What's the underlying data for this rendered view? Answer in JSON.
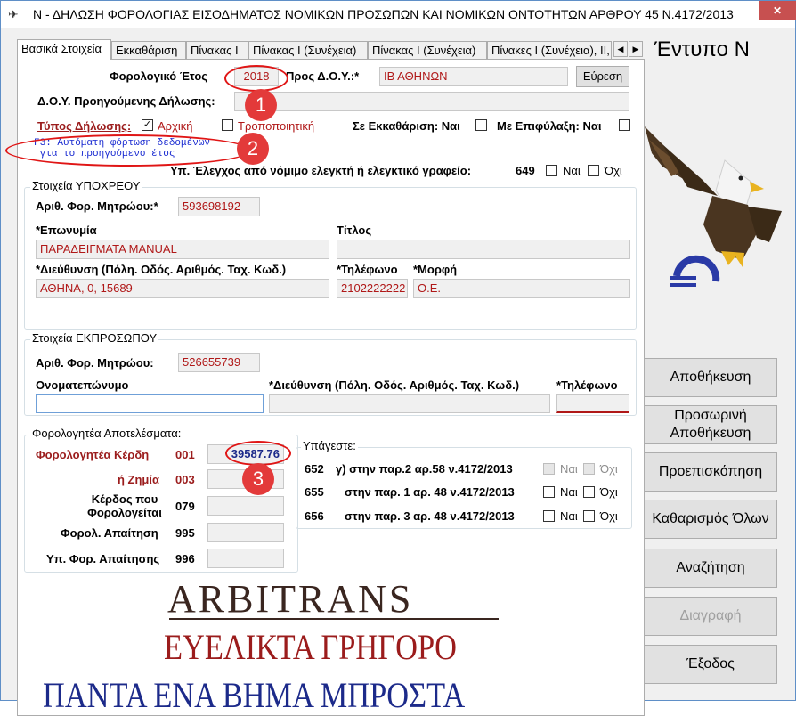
{
  "window": {
    "title": "Ν - ΔΗΛΩΣΗ ΦΟΡΟΛΟΓΙΑΣ ΕΙΣΟΔΗΜΑΤΟΣ ΝΟΜΙΚΩΝ ΠΡΟΣΩΠΩΝ ΚΑΙ ΝΟΜΙΚΩΝ ΟΝΤΟΤΗΤΩΝ ΑΡΘΡΟΥ 45 Ν.4172/2013",
    "close_label": "✕"
  },
  "tabs": [
    {
      "label": "Βασικά Στοιχεία"
    },
    {
      "label": "Εκκαθάριση"
    },
    {
      "label": "Πίνακας Ι"
    },
    {
      "label": "Πίνακας Ι (Συνέχεια)"
    },
    {
      "label": "Πίνακας Ι (Συνέχεια)"
    },
    {
      "label": "Πίνακες Ι (Συνέχεια), ΙΙ,"
    }
  ],
  "tab_arrows": {
    "left": "◀",
    "right": "▶"
  },
  "header": {
    "fiscal_year_label": "Φορολογικό Έτος",
    "fiscal_year_value": "2018",
    "doy_label": "Προς Δ.Ο.Υ.:*",
    "doy_value": "ΙΒ ΑΘΗΝΩΝ",
    "search_button": "Εύρεση",
    "prev_doy_label": "Δ.Ο.Υ. Προηγούμενης Δήλωσης:",
    "prev_doy_value": "",
    "decl_type_label": "Τύπος Δήλωσης:",
    "initial_label": "Αρχική",
    "amending_label": "Τροποποιητική",
    "liquidation_label": "Σε Εκκαθάριση: Ναι",
    "reservation_label": "Με Επιφύλαξη: Ναι",
    "hint_text": "F3: Αυτόματη φόρτωση δεδομένων\n για το προηγούμενο έτος",
    "audit_label": "Υπ. Έλεγχος από νόμιμο ελεγκτή ή ελεγκτικό γραφείο:",
    "audit_code": "649",
    "yes_label": "Ναι",
    "no_label": "Όχι"
  },
  "obligor": {
    "group_title": "Στοιχεία ΥΠΟΧΡΕΟΥ",
    "afm_label": "Αριθ. Φορ. Μητρώου:*",
    "afm_value": "593698192",
    "name_label": "*Επωνυμία",
    "name_value": "ΠΑΡΑΔΕΙΓΜΑΤΑ MANUAL",
    "title_label": "Τίτλος",
    "title_value": "",
    "address_label": "*Διεύθυνση (Πόλη. Οδός. Αριθμός. Ταχ. Κωδ.)",
    "address_value": "ΑΘΗΝΑ, 0, 15689",
    "phone_label": "*Τηλέφωνο",
    "phone_value": "2102222222",
    "form_label": "*Μορφή",
    "form_value": "Ο.Ε."
  },
  "representative": {
    "group_title": "Στοιχεία ΕΚΠΡΟΣΩΠΟΥ",
    "afm_label": "Αριθ. Φορ. Μητρώου:",
    "afm_value": "526655739",
    "fullname_label": "Ονοματεπώνυμο",
    "address_label": "*Διεύθυνση (Πόλη. Οδός. Αριθμός. Ταχ. Κωδ.)",
    "phone_label": "*Τηλέφωνο"
  },
  "results": {
    "group_title": "Φορολογητέα Αποτελέσματα:",
    "rows": [
      {
        "label": "Φορολογητέα Κέρδη",
        "code": "001",
        "value": "39587.76"
      },
      {
        "label": "ή Ζημία",
        "code": "003",
        "value": ""
      },
      {
        "label": "Κέρδος που Φορολογείται",
        "code": "079",
        "value": ""
      },
      {
        "label": "Φορολ. Απαίτηση",
        "code": "995",
        "value": ""
      },
      {
        "label": "Υπ. Φορ. Απαίτησης",
        "code": "996",
        "value": ""
      }
    ]
  },
  "subject": {
    "group_title": "Υπάγεστε:",
    "rows": [
      {
        "code": "652",
        "label": "γ) στην παρ.2 αρ.58 ν.4172/2013"
      },
      {
        "code": "655",
        "label": "στην παρ. 1 αρ. 48 ν.4172/2013"
      },
      {
        "code": "656",
        "label": "στην παρ. 3 αρ. 48 ν.4172/2013"
      }
    ]
  },
  "branding": {
    "form_title": "Έντυπο Ν",
    "line1": "ARBITRANS",
    "line2": "ΕΥΕΛΙΚΤΑ ΓΡΗΓΟΡΟ",
    "line3": "ΠΑΝΤΑ ΕΝΑ ΒΗΜΑ ΜΠΡΟΣΤΑ"
  },
  "actions": {
    "save": "Αποθήκευση",
    "temp_save": "Προσωρινή Αποθήκευση",
    "preview": "Προεπισκόπηση",
    "clear_all": "Καθαρισμός Όλων",
    "search": "Αναζήτηση",
    "delete": "Διαγραφή",
    "exit": "Έξοδος"
  },
  "annotations": {
    "m1": "1",
    "m2": "2",
    "m3": "3"
  },
  "colors": {
    "accent_red": "#e01515",
    "label_red": "#b01818",
    "hint_blue": "#1a2bd1",
    "brand_dark": "#3a2620",
    "brand_red": "#9b1c1c",
    "brand_blue": "#1c2a8a"
  }
}
